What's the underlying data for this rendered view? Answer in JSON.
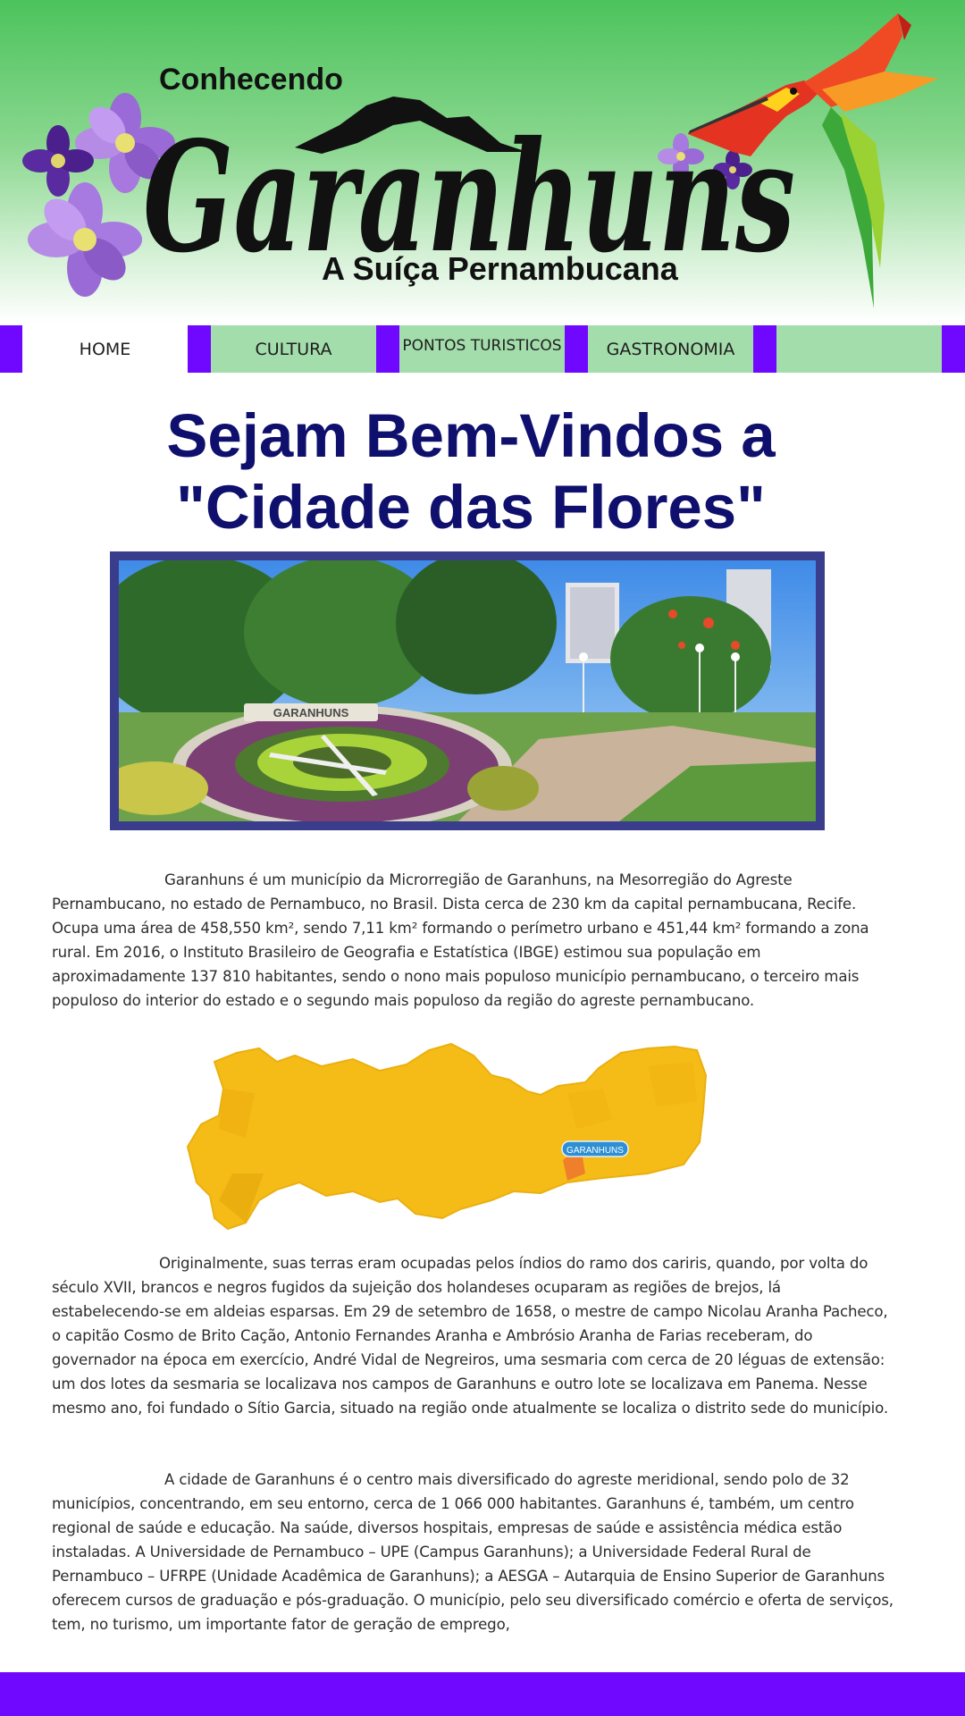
{
  "header": {
    "logo_top": "Conhecendo",
    "logo_main": "Garanhuns",
    "logo_sub": "A Suíça Pernambucana"
  },
  "nav": {
    "home": "HOME",
    "cultura": "CULTURA",
    "pontos": "PONTOS TURISTICOS",
    "gastronomia": "GASTRONOMIA",
    "extra": ""
  },
  "title": {
    "line1": "Sejam Bem-Vindos a",
    "line2": "\"Cidade das Flores\""
  },
  "photo": {
    "sign_text": "GARANHUNS"
  },
  "paragraphs": [
    "Garanhuns é um município da Microrregião de Garanhuns, na Mesorregião do Agreste Pernambucano, no estado de Pernambuco, no Brasil. Dista cerca de 230 km da capital pernambucana, Recife. Ocupa uma área de 458,550 km², sendo 7,11 km² formando o perímetro urbano e 451,44 km² formando a zona rural. Em 2016, o Instituto Brasileiro de Geografia e Estatística (IBGE) estimou sua população em aproximadamente 137 810 habitantes, sendo o nono mais populoso município pernambucano, o terceiro mais populoso do interior do estado e o segundo mais populoso da região do agreste pernambucano.",
    "Originalmente, suas terras eram ocupadas pelos índios do ramo dos cariris, quando, por volta do século XVII, brancos e negros fugidos da sujeição dos holandeses ocuparam as regiões de brejos, lá estabelecendo-se em aldeias esparsas. Em 29 de setembro de 1658, o mestre de campo Nicolau Aranha Pacheco, o capitão Cosmo de Brito Cação, Antonio Fernandes Aranha e Ambrósio Aranha de Farias receberam, do governador na época em exercício, André Vidal de Negreiros, uma sesmaria com cerca de 20 léguas de extensão: um dos lotes da sesmaria se localizava nos campos de Garanhuns e outro lote se localizava em Panema. Nesse mesmo ano, foi fundado o Sítio Garcia, situado na região onde atualmente se localiza o distrito sede do município.",
    "A cidade de Garanhuns é o centro mais diversificado do agreste meridional, sendo polo de 32 municípios, concentrando, em seu entorno, cerca de 1 066 000 habitantes. Garanhuns é, também, um centro regional de saúde e educação. Na saúde, diversos hospitais, empresas de saúde e assistência médica estão instaladas. A Universidade de Pernambuco – UPE (Campus Garanhuns); a Universidade Federal Rural de Pernambuco – UFRPE (Unidade Acadêmica de Garanhuns); a AESGA – Autarquia de Ensino Superior de Garanhuns oferecem cursos de graduação e pós-graduação. O município, pelo seu diversificado comércio e oferta de serviços, tem, no turismo, um importante fator de geração de emprego,"
  ],
  "map": {
    "label": "GARANHUNS"
  },
  "colors": {
    "nav_bar": "#7008ff",
    "nav_green": "#a4ddac",
    "title": "#0f0f6e",
    "map_fill": "#f5bc17"
  }
}
